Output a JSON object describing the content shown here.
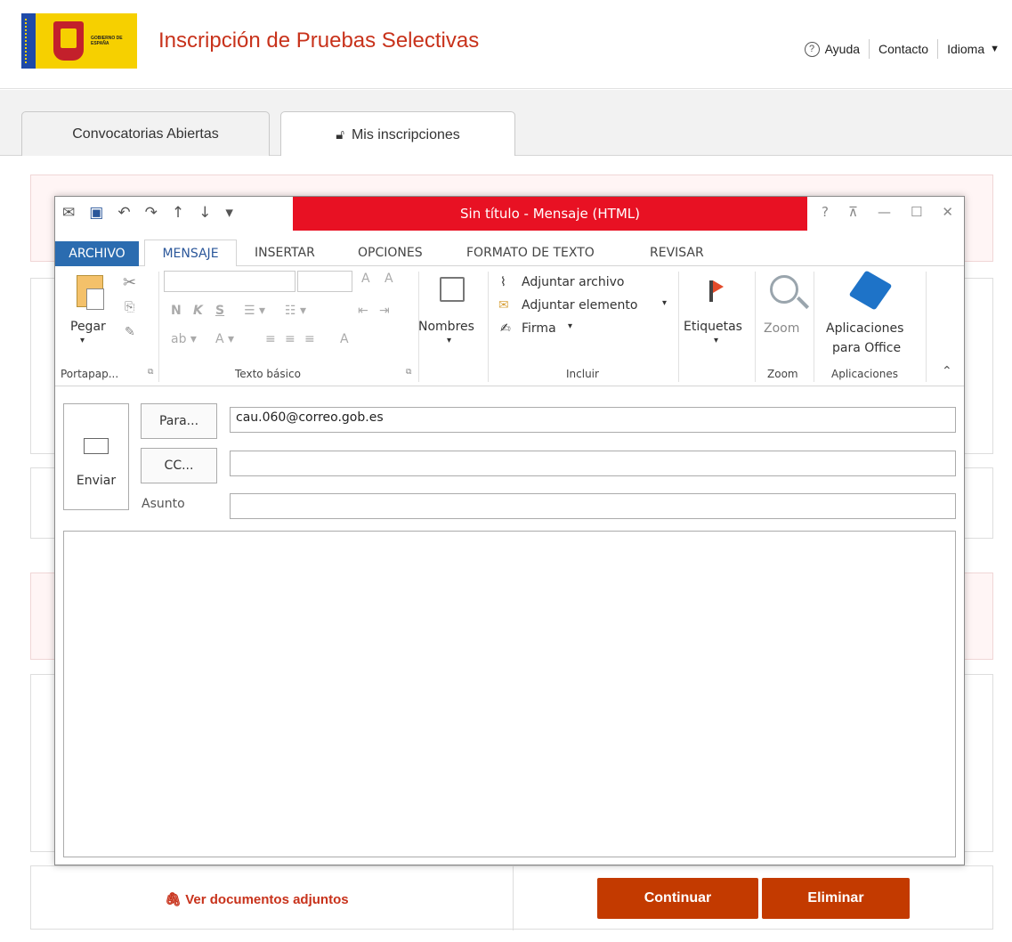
{
  "header": {
    "site_title": "Inscripción de Pruebas Selectivas",
    "logo_text": "GOBIERNO DE ESPAÑA",
    "nav": {
      "help_icon": "?",
      "help": "Ayuda",
      "contact": "Contacto",
      "language": "Idioma"
    }
  },
  "tabs": [
    {
      "label": "Convocatorias Abiertas"
    },
    {
      "label": "Mis inscripciones",
      "icon": "lock-icon"
    }
  ],
  "outlook": {
    "title": "Sin título -  Mensaje (HTML)",
    "window_controls": [
      "?",
      "⊼",
      "—",
      "☐",
      "✕"
    ],
    "ribbon_tabs": [
      "ARCHIVO",
      "MENSAJE",
      "INSERTAR",
      "OPCIONES",
      "FORMATO DE TEXTO",
      "REVISAR"
    ],
    "clipboard": {
      "paste": "Pegar",
      "group": "Portapap..."
    },
    "basic_text": {
      "group": "Texto básico",
      "bold": "N",
      "italic": "K",
      "underline": "S"
    },
    "names": {
      "label": "Nombres"
    },
    "include": {
      "attach_file": "Adjuntar archivo",
      "attach_item": "Adjuntar elemento",
      "signature": "Firma",
      "group": "Incluir"
    },
    "tags": {
      "label": "Etiquetas"
    },
    "zoom": {
      "label": "Zoom",
      "group": "Zoom"
    },
    "apps": {
      "label_line1": "Aplicaciones",
      "label_line2": "para Office",
      "group": "Aplicaciones"
    },
    "compose": {
      "send": "Enviar",
      "to_button": "Para...",
      "cc_button": "CC...",
      "subject_label": "Asunto",
      "to_value": "cau.060@correo.gob.es",
      "cc_value": "",
      "subject_value": ""
    }
  },
  "footer_actions": {
    "attachments_link": "Ver documentos adjuntos",
    "continue": "Continuar",
    "delete": "Eliminar"
  }
}
